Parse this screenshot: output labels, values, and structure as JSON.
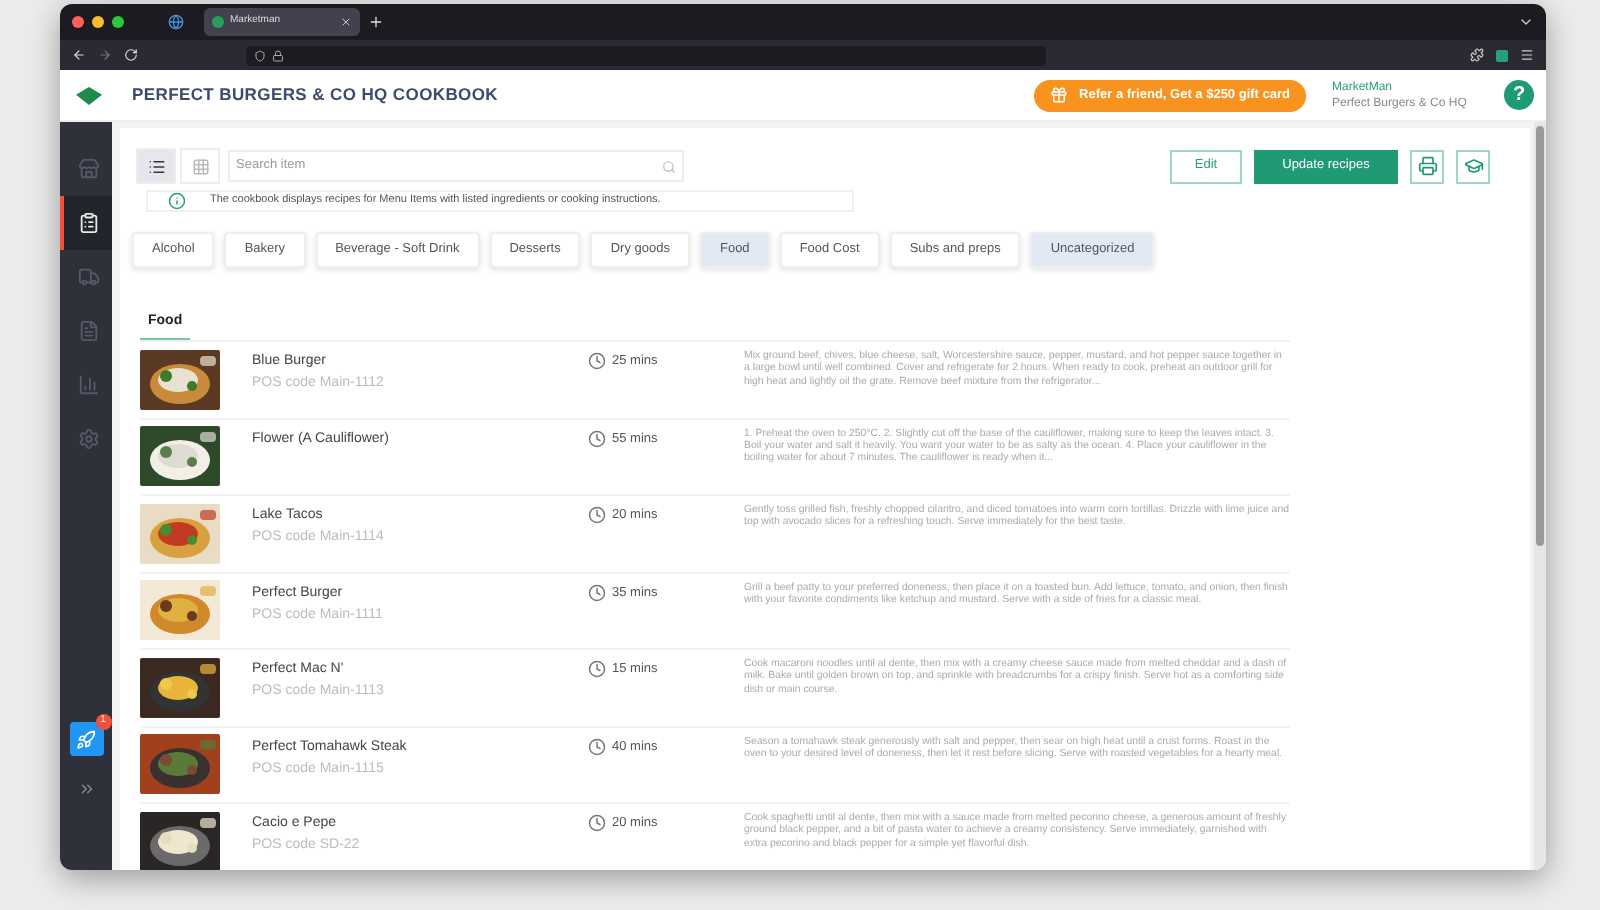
{
  "browser": {
    "tab_title": "Marketman"
  },
  "header": {
    "title": "PERFECT BURGERS & CO HQ COOKBOOK",
    "referral": "Refer a friend, Get a $250 gift card",
    "account": "MarketMan",
    "location": "Perfect Burgers & Co HQ",
    "help": "?"
  },
  "sidebar": {
    "items": [
      {
        "kind": "inventory",
        "selected": false
      },
      {
        "kind": "recipes",
        "selected": true
      },
      {
        "kind": "delivery",
        "selected": false
      },
      {
        "kind": "orders",
        "selected": false
      },
      {
        "kind": "reports",
        "selected": false
      },
      {
        "kind": "settings",
        "selected": false
      }
    ],
    "launch_badge": "1"
  },
  "toolbar": {
    "view_modes": [
      {
        "kind": "list",
        "selected": true
      },
      {
        "kind": "grid",
        "selected": false
      }
    ],
    "search": {
      "placeholder": "Search item"
    },
    "edit": "Edit",
    "update": "Update recipes"
  },
  "info": "The cookbook displays recipes for Menu Items with listed ingredients or cooking instructions.",
  "categories": [
    {
      "label": "Alcohol",
      "selected": false
    },
    {
      "label": "Bakery",
      "selected": false
    },
    {
      "label": "Beverage - Soft Drink",
      "selected": false
    },
    {
      "label": "Desserts",
      "selected": false
    },
    {
      "label": "Dry goods",
      "selected": false
    },
    {
      "label": "Food",
      "selected": true
    },
    {
      "label": "Food Cost",
      "selected": false
    },
    {
      "label": "Subs and preps",
      "selected": false
    },
    {
      "label": "Uncategorized",
      "selected": true
    }
  ],
  "section_title": "Food",
  "recipes": [
    {
      "name": "Blue Burger",
      "pos_code": "POS code Main-1112",
      "time": "25 mins",
      "description": "Mix ground beef, chives, blue cheese, salt, Worcestershire sauce, pepper, mustard, and hot pepper sauce together in a large bowl until well combined. Cover and refrigerate for 2 hours. When ready to cook, preheat an outdoor grill for high heat and lightly oil the grate. Remove beef mixture from the refrigerator..."
    },
    {
      "name": "Flower (A Cauliflower)",
      "time": "55 mins",
      "description": "1. Preheat the oven to 250°C. 2. Slightly cut off the base of the cauliflower, making sure to keep the leaves intact. 3. Boil your water and salt it heavily. You want your water to be as salty as the ocean. 4. Place your cauliflower in the boiling water for about 7 minutes. The cauliflower is ready when it..."
    },
    {
      "name": "Lake Tacos",
      "pos_code": "POS code Main-1114",
      "time": "20 mins",
      "description": "Gently toss grilled fish, freshly chopped cilantro, and diced tomatoes into warm corn tortillas. Drizzle with lime juice and top with avocado slices for a refreshing touch. Serve immediately for the best taste."
    },
    {
      "name": "Perfect Burger",
      "pos_code": "POS code Main-1111",
      "time": "35 mins",
      "description": "Grill a beef patty to your preferred doneness, then place it on a toasted bun. Add lettuce, tomato, and onion, then finish with your favorite condiments like ketchup and mustard. Serve with a side of fries for a classic meal."
    },
    {
      "name": "Perfect Mac N'",
      "pos_code": "POS code Main-1113",
      "time": "15 mins",
      "description": "Cook macaroni noodles until al dente, then mix with a creamy cheese sauce made from melted cheddar and a dash of milk. Bake until golden brown on top, and sprinkle with breadcrumbs for a crispy finish. Serve hot as a comforting side dish or main course."
    },
    {
      "name": "Perfect Tomahawk Steak",
      "pos_code": "POS code Main-1115",
      "time": "40 mins",
      "description": "Season a tomahawk steak generously with salt and pepper, then sear on high heat until a crust forms. Roast in the oven to your desired level of doneness, then let it rest before slicing. Serve with roasted vegetables for a hearty meal."
    },
    {
      "name": "Cacio e Pepe",
      "pos_code": "POS code SD-22",
      "time": "20 mins",
      "description": "Cook spaghetti until al dente, then mix with a sauce made from melted pecorino cheese, a generous amount of freshly ground black pepper, and a bit of pasta water to achieve a creamy consistency. Serve immediately, garnished with extra pecorino and black pepper for a simple yet flavorful dish."
    }
  ]
}
